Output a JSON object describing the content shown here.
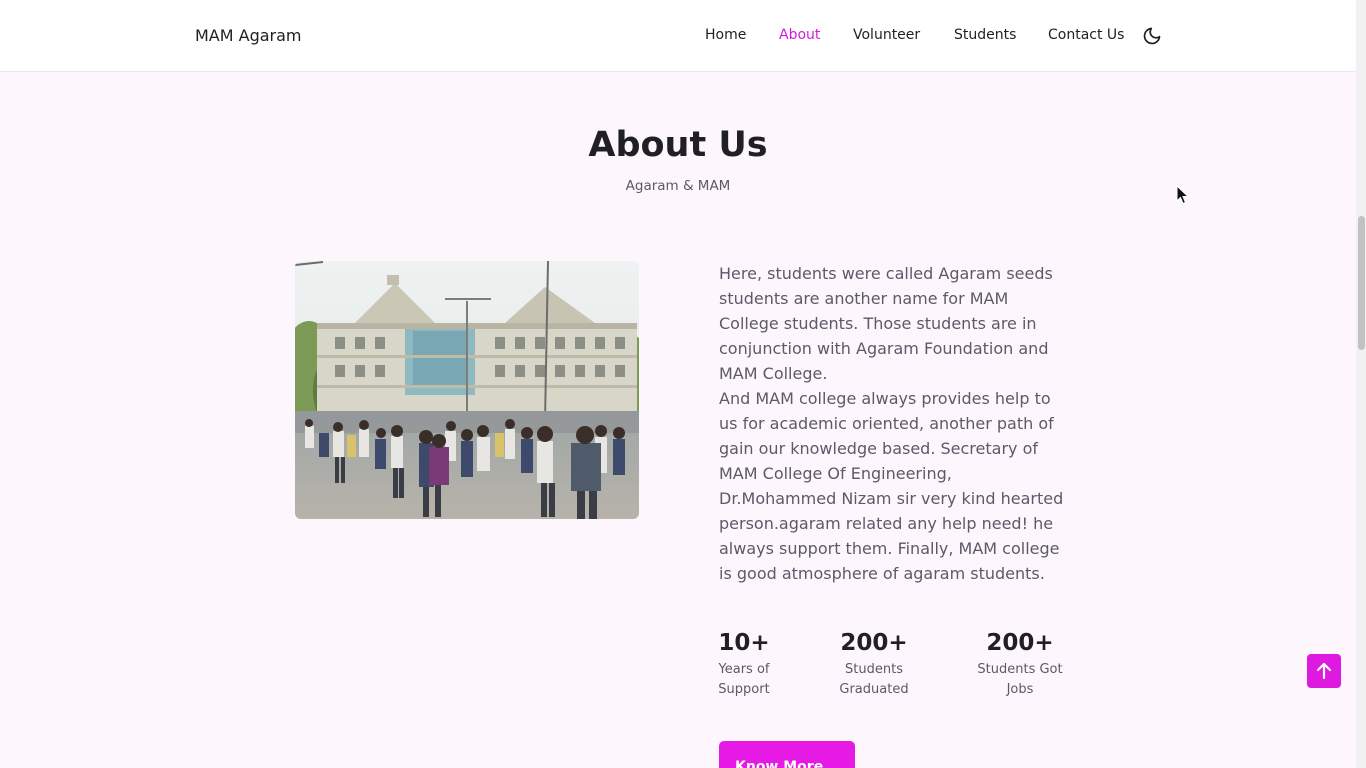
{
  "header": {
    "brand": "MAM Agaram",
    "nav": [
      {
        "label": "Home",
        "active": false
      },
      {
        "label": "About",
        "active": true
      },
      {
        "label": "Volunteer",
        "active": false
      },
      {
        "label": "Students",
        "active": false
      },
      {
        "label": "Contact Us",
        "active": false
      }
    ],
    "theme_icon": "moon-icon"
  },
  "about": {
    "title": "About Us",
    "subtitle": "Agaram & MAM",
    "paragraphs": [
      "Here, students were called Agaram seeds students are another name for MAM College students. Those students are in conjunction with Agaram Foundation and MAM College.",
      "And MAM college always provides help to us for academic oriented, another path of gain our knowledge based. Secretary of MAM College Of Engineering, Dr.Mohammed Nizam sir very kind hearted person.agaram related any help need! he always support them. Finally, MAM college is good atmosphere of agaram students."
    ],
    "stats": [
      {
        "number": "10+",
        "label": "Years of Support"
      },
      {
        "number": "200+",
        "label": "Students Graduated"
      },
      {
        "number": "200+",
        "label": "Students Got Jobs"
      }
    ],
    "button": "Know More"
  },
  "scroll_top_icon": "arrow-up-icon",
  "colors": {
    "accent": "#d21bd9",
    "button": "#e51ae5",
    "background": "#fdf7fd"
  }
}
